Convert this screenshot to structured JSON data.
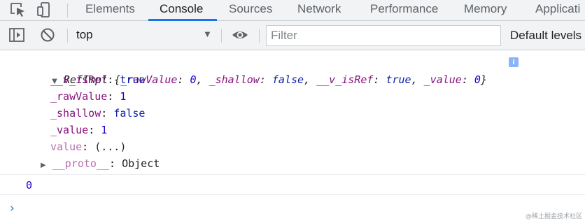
{
  "tabs": [
    {
      "label": "Elements"
    },
    {
      "label": "Console"
    },
    {
      "label": "Sources"
    },
    {
      "label": "Network"
    },
    {
      "label": "Performance"
    },
    {
      "label": "Memory"
    },
    {
      "label": "Applicati"
    }
  ],
  "active_tab": "Console",
  "toolbar": {
    "context": "top",
    "filter_placeholder": "Filter",
    "levels_label": "Default levels"
  },
  "console": {
    "object_name": "RefImpl",
    "preview": {
      "open": "{",
      "k1": "_rawValue",
      "v1": "0",
      "k2": "_shallow",
      "v2": "false",
      "k3": "__v_isRef",
      "v3": "true",
      "k4": "_value",
      "v4": "0",
      "close": "}"
    },
    "props": [
      {
        "key": "__v_isRef",
        "value": "true"
      },
      {
        "key": "_rawValue",
        "value": "1"
      },
      {
        "key": "_shallow",
        "value": "false"
      },
      {
        "key": "_value",
        "value": "1"
      },
      {
        "key": "value",
        "value": "(...)"
      },
      {
        "key": "__proto__",
        "value": "Object"
      }
    ],
    "output_value": "0",
    "prompt_symbol": "›"
  },
  "watermark": "@稀土掘金技术社区",
  "colors": {
    "accent": "#1a73e8",
    "property_key": "#881280",
    "number": "#1c00cf",
    "keyword": "#0d22aa"
  }
}
